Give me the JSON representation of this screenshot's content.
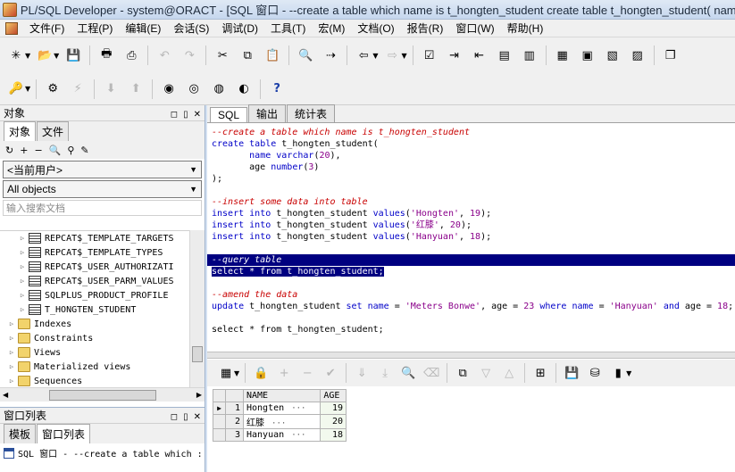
{
  "window": {
    "title": "PL/SQL Developer - system@ORACT - [SQL 窗口 - --create a table which name is t_hongten_student create table t_hongten_student( name"
  },
  "menu": {
    "items": [
      "文件(F)",
      "工程(P)",
      "编辑(E)",
      "会话(S)",
      "调试(D)",
      "工具(T)",
      "宏(M)",
      "文档(O)",
      "报告(R)",
      "窗口(W)",
      "帮助(H)"
    ]
  },
  "left_panel": {
    "title": "对象",
    "tabs": [
      "对象",
      "文件"
    ],
    "user_combo": "<当前用户>",
    "filter_combo": "All objects",
    "search_placeholder": "输入搜索文档",
    "tree_items": [
      {
        "label": "REPCAT$_TEMPLATE_TARGETS",
        "type": "table"
      },
      {
        "label": "REPCAT$_TEMPLATE_TYPES",
        "type": "table"
      },
      {
        "label": "REPCAT$_USER_AUTHORIZATI",
        "type": "table"
      },
      {
        "label": "REPCAT$_USER_PARM_VALUES",
        "type": "table"
      },
      {
        "label": "SQLPLUS_PRODUCT_PROFILE",
        "type": "table"
      },
      {
        "label": "T_HONGTEN_STUDENT",
        "type": "table"
      },
      {
        "label": "Indexes",
        "type": "folder"
      },
      {
        "label": "Constraints",
        "type": "folder"
      },
      {
        "label": "Views",
        "type": "folder"
      },
      {
        "label": "Materialized views",
        "type": "folder"
      },
      {
        "label": "Sequences",
        "type": "folder"
      }
    ]
  },
  "window_list": {
    "title": "窗口列表",
    "tabs": [
      "模板",
      "窗口列表"
    ],
    "item": "SQL 窗口 - --create a table which :"
  },
  "editor": {
    "tabs": [
      "SQL",
      "输出",
      "统计表"
    ],
    "comment_create": "--create a table which name is t_hongten_student",
    "comment_insert": "--insert some data into table",
    "comment_query": "--query table",
    "query_line": "select * from t_hongten_student;",
    "comment_amend": "--amend the data",
    "select_line": "select * from t_hongten_student;"
  },
  "result_grid": {
    "columns": [
      "NAME",
      "AGE"
    ],
    "rows": [
      {
        "num": "1",
        "name": "Hongten",
        "age": "19"
      },
      {
        "num": "2",
        "name": "红膝",
        "age": "20"
      },
      {
        "num": "3",
        "name": "Hanyuan",
        "age": "18"
      }
    ],
    "more_glyph": "···"
  }
}
